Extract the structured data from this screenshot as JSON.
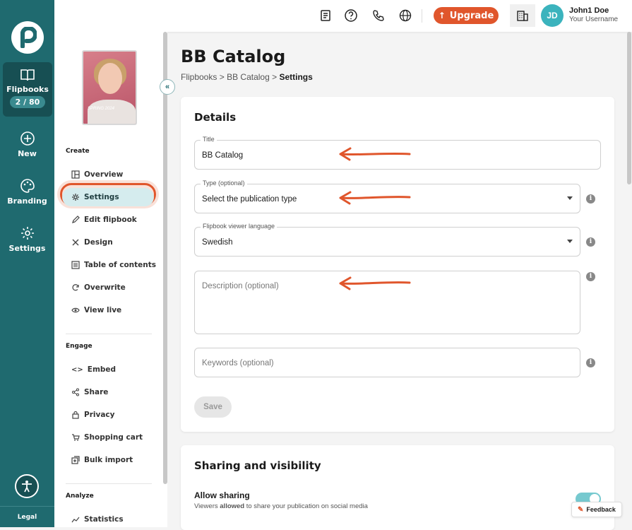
{
  "rail": {
    "items": [
      {
        "label": "Flipbooks",
        "badge": "2 / 80",
        "icon": "book-icon"
      },
      {
        "label": "New",
        "icon": "plus-circle-icon"
      },
      {
        "label": "Branding",
        "icon": "palette-icon"
      },
      {
        "label": "Settings",
        "icon": "gear-icon"
      }
    ],
    "legal": "Legal"
  },
  "topbar": {
    "upgrade_label": "Upgrade",
    "avatar_initials": "JD",
    "user_name": "John1 Doe",
    "user_sub": "Your Username"
  },
  "sidebar": {
    "thumbnail_text": "SPRING 2024",
    "sections": {
      "create": "Create",
      "engage": "Engage",
      "analyze": "Analyze"
    },
    "create_items": [
      "Overview",
      "Settings",
      "Edit flipbook",
      "Design",
      "Table of contents",
      "Overwrite",
      "View live"
    ],
    "engage_items": [
      "Embed",
      "Share",
      "Privacy",
      "Shopping cart",
      "Bulk import"
    ],
    "analyze_items": [
      "Statistics"
    ]
  },
  "main": {
    "title": "BB Catalog",
    "breadcrumb": {
      "b1": "Flipbooks",
      "b2": "BB Catalog",
      "current": "Settings",
      "sep": ">"
    },
    "details": {
      "heading": "Details",
      "title_label": "Title",
      "title_value": "BB Catalog",
      "type_label": "Type (optional)",
      "type_value": "Select the publication type",
      "language_label": "Flipbook viewer language",
      "language_value": "Swedish",
      "description_placeholder": "Description (optional)",
      "keywords_placeholder": "Keywords (optional)",
      "save_label": "Save"
    },
    "sharing": {
      "heading": "Sharing and visibility",
      "allow_label": "Allow sharing",
      "allow_desc_pre": "Viewers ",
      "allow_desc_bold": "allowed",
      "allow_desc_post": " to share your publication on social media",
      "allow_on": true
    }
  },
  "feedback_label": "Feedback",
  "colors": {
    "rail": "#1f6a6f",
    "accent": "#e0562c",
    "active_bg": "#d5ecee"
  }
}
